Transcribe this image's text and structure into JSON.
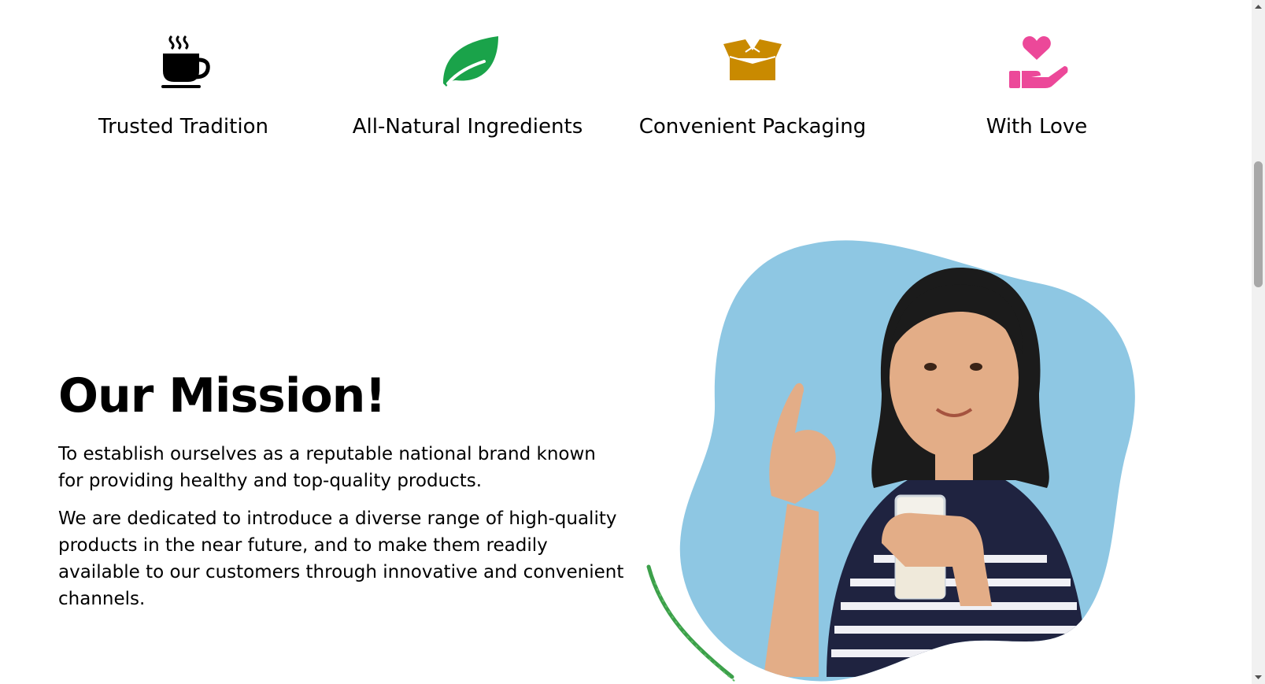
{
  "features": [
    {
      "label": "Trusted Tradition",
      "icon": "coffee-cup-icon",
      "color": "#000000"
    },
    {
      "label": "All-Natural Ingredients",
      "icon": "leaf-icon",
      "color": "#1aa34a"
    },
    {
      "label": "Convenient Packaging",
      "icon": "open-box-icon",
      "color": "#c98a00"
    },
    {
      "label": "With Love",
      "icon": "heart-hand-icon",
      "color": "#ec4899"
    }
  ],
  "mission": {
    "title": "Our Mission!",
    "paragraph1": "To establish ourselves as a reputable national brand known for providing healthy and top-quality products.",
    "paragraph2": "We are dedicated to introduce a diverse range of high-quality products in the near future, and to make them readily available to our customers through innovative and convenient channels."
  },
  "hero": {
    "image": "girl-holding-milk-glass-illustration",
    "blob_color": "#8ec7e3",
    "accent_color": "#3ca04a"
  }
}
